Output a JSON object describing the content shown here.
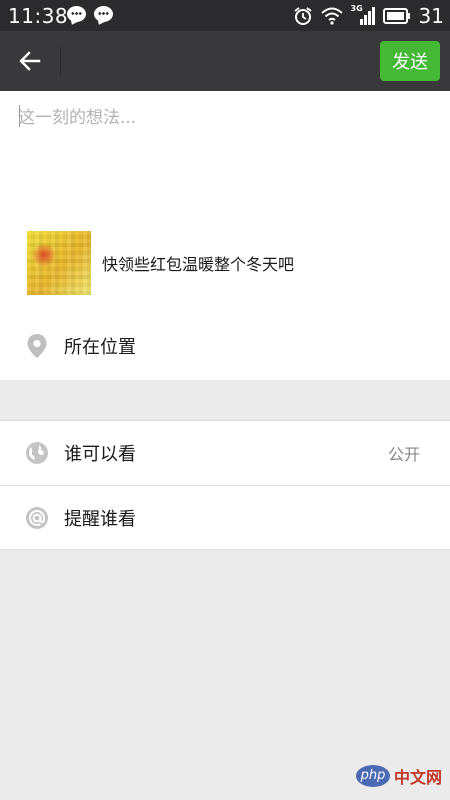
{
  "status_bar": {
    "time": "11:38",
    "battery_level": "31",
    "network_type": "3G",
    "notification_icons": [
      "chat-bubble-icon",
      "chat-bubble-icon"
    ],
    "system_icons": [
      "alarm-clock-icon",
      "wifi-icon",
      "signal-icon",
      "battery-icon"
    ]
  },
  "title_bar": {
    "back_icon": "arrow-left-icon",
    "send_label": "发送",
    "accent_color": "#45b936"
  },
  "composer": {
    "placeholder": "这一刻的想法...",
    "value": ""
  },
  "shared_link": {
    "title": "快领些红包温暖整个冬天吧",
    "thumbnail": "blurred-red-packet-thumbnail"
  },
  "location": {
    "icon": "location-pin-icon",
    "label": "所在位置"
  },
  "settings": [
    {
      "icon": "globe-icon",
      "label": "谁可以看",
      "value": "公开"
    },
    {
      "icon": "at-sign-icon",
      "label": "提醒谁看",
      "value": ""
    }
  ],
  "watermark": {
    "badge": "php",
    "text": "中文网"
  }
}
